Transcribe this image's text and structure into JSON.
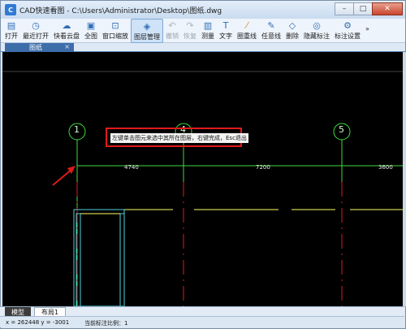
{
  "window": {
    "app_icon_text": "C",
    "title": "CAD快速看图 - C:\\Users\\Administrator\\Desktop\\图纸.dwg",
    "minimize": "–",
    "maximize": "□",
    "close": "✕"
  },
  "toolbar": {
    "items": [
      {
        "label": "打开",
        "icon": "folder-icon"
      },
      {
        "label": "最近打开",
        "icon": "recent-icon"
      },
      {
        "label": "快看云盘",
        "icon": "cloud-icon"
      },
      {
        "label": "全图",
        "icon": "fullview-icon"
      },
      {
        "label": "窗口缩放",
        "icon": "window-zoom-icon"
      },
      {
        "label": "图层管理",
        "icon": "layers-icon"
      },
      {
        "label": "撤销",
        "icon": "undo-icon"
      },
      {
        "label": "恢复",
        "icon": "redo-icon"
      },
      {
        "label": "测量",
        "icon": "measure-icon"
      },
      {
        "label": "文字",
        "icon": "text-icon"
      },
      {
        "label": "圈重线",
        "icon": "cloud-line-icon"
      },
      {
        "label": "任意线",
        "icon": "pen-icon"
      },
      {
        "label": "删除",
        "icon": "eraser-icon"
      },
      {
        "label": "隐藏标注",
        "icon": "eye-icon"
      },
      {
        "label": "标注设置",
        "icon": "settings-icon"
      }
    ],
    "more": "»"
  },
  "doc_tab": {
    "label": "图纸",
    "close": "×"
  },
  "drawing": {
    "hint": "左键单击图元来选中其所在图层，右键完成，Esc退出",
    "grid_labels": [
      "1",
      "4",
      "5"
    ],
    "dimensions": [
      "4740",
      "7200",
      "3600"
    ]
  },
  "layout_tabs": {
    "model": "模型",
    "layout1": "布局1"
  },
  "status": {
    "coords": "x = 262448  y = -3001",
    "scale": "当前标注比例：1"
  },
  "colors": {
    "canvas_bg": "#000000",
    "grid_line": "#3ddc3d",
    "axis_red": "#e01a1a",
    "wall_cyan": "#4fd1e0",
    "wall_yellow": "#ffff66"
  }
}
